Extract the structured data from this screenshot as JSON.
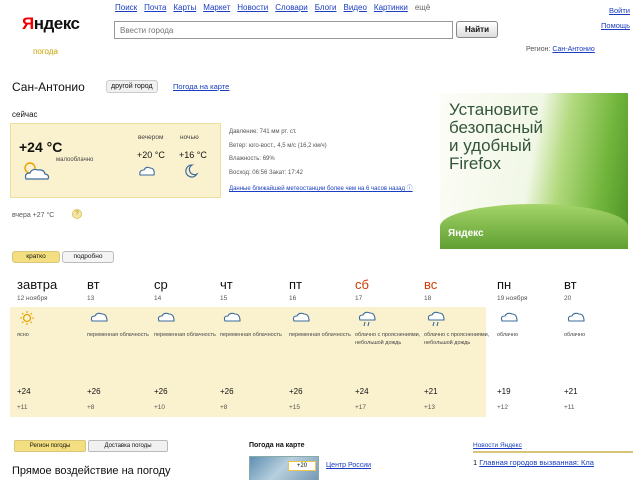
{
  "header": {
    "logo": "Яндекс",
    "logo_first_letter": "Я",
    "logo_rest": "ндекс",
    "logo_sub": "погода",
    "nav": [
      "Поиск",
      "Почта",
      "Карты",
      "Маркет",
      "Новости",
      "Словари",
      "Блоги",
      "Видео",
      "Картинки",
      "ещё"
    ],
    "login": "Войти",
    "settings": "Помощь",
    "search_placeholder": "Ввести города",
    "search_button": "Найти",
    "region_label": "Регион:",
    "region_value": "Сан-Антонио"
  },
  "city": {
    "name": "Сан-Антонио",
    "other_city": "другой город",
    "map_link": "Погода на карте"
  },
  "now": {
    "label": "сейчас",
    "temp": "+24 °C",
    "condition": "малооблачно",
    "evening_label": "вечером",
    "evening_temp": "+20 °C",
    "night_label": "ночью",
    "night_temp": "+16 °C",
    "details": [
      "Давление: 741 мм рт. ст.",
      "Ветер: юго-вост., 4,5 м/с (16,2 км/ч)",
      "Влажность: 69%",
      "Восход: 06:56 Закат: 17:42"
    ],
    "details_link": "Данные ближайшей метеостанции более чем на 6 часов назад ⓘ",
    "yesterday": "вчера +27 °C",
    "yesterday_badge": "?"
  },
  "ad": {
    "text_line1": "Установите",
    "text_line2": "безопасный",
    "text_line3": "и удобный",
    "text_line4": "Firefox",
    "brand": "Яндекс"
  },
  "tabs": {
    "short": "кратко",
    "detail": "подробно"
  },
  "forecast": [
    {
      "day": "завтра",
      "date": "12 ноября",
      "cond": "ясно",
      "high": "+24",
      "low": "+11",
      "icon": "sun",
      "weekend": false
    },
    {
      "day": "вт",
      "date": "13",
      "cond": "переменная облачность",
      "high": "+26",
      "low": "+8",
      "icon": "cloud",
      "weekend": false
    },
    {
      "day": "ср",
      "date": "14",
      "cond": "переменная облачность",
      "high": "+26",
      "low": "+10",
      "icon": "cloud",
      "weekend": false
    },
    {
      "day": "чт",
      "date": "15",
      "cond": "переменная облачность",
      "high": "+26",
      "low": "+8",
      "icon": "cloud",
      "weekend": false
    },
    {
      "day": "пт",
      "date": "16",
      "cond": "переменная облачность",
      "high": "+26",
      "low": "+15",
      "icon": "cloud",
      "weekend": false
    },
    {
      "day": "сб",
      "date": "17",
      "cond": "облачно с прояснениями, небольшой дождь",
      "high": "+24",
      "low": "+17",
      "icon": "rain",
      "weekend": true
    },
    {
      "day": "вс",
      "date": "18",
      "cond": "облачно с прояснениями, небольшой дождь",
      "high": "+21",
      "low": "+13",
      "icon": "rain",
      "weekend": true
    },
    {
      "day": "пн",
      "date": "19 ноября",
      "cond": "облачно",
      "high": "+19",
      "low": "+12",
      "icon": "cloud",
      "weekend": false
    },
    {
      "day": "вт",
      "date": "20",
      "cond": "облачно",
      "high": "+21",
      "low": "+11",
      "icon": "cloud",
      "weekend": false
    }
  ],
  "bottom": {
    "tab_regions": "Регион погоды",
    "tab_delivery": "Доставка погоды",
    "title": "Прямое воздействие на погоду",
    "map_title": "Погода на карте",
    "map_badge": "+20",
    "center_link": "Центр России",
    "news_head": "Новости Яндекс",
    "news_num": "1",
    "news_text": "Главная городов вызванная: Кла"
  },
  "colors": {
    "panel": "#faf2cf",
    "link": "#1a3dc1",
    "weekend": "#d13b00",
    "logo_red": "#ee0000"
  }
}
